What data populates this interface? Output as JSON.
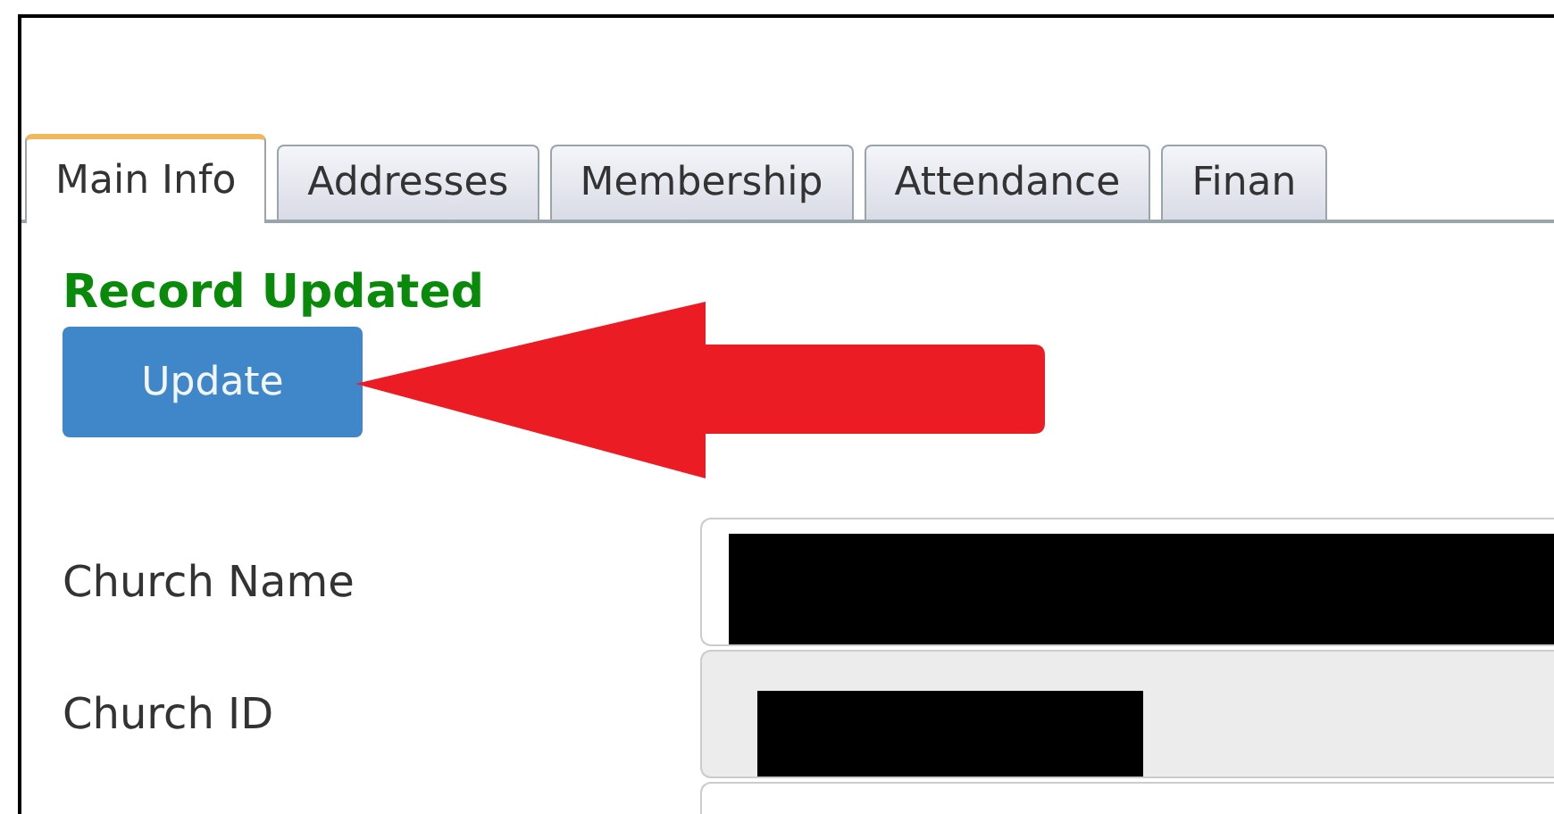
{
  "tabs": [
    {
      "label": "Main Info",
      "selected": true
    },
    {
      "label": "Addresses",
      "selected": false
    },
    {
      "label": "Membership",
      "selected": false
    },
    {
      "label": "Attendance",
      "selected": false
    },
    {
      "label": "Finan",
      "selected": false
    }
  ],
  "status_message": "Record Updated",
  "update_button": "Update",
  "fields": [
    {
      "label": "Church Name",
      "disabled": false,
      "redacted": true
    },
    {
      "label": "Church ID",
      "disabled": true,
      "redacted": true
    },
    {
      "disabled": false
    }
  ]
}
